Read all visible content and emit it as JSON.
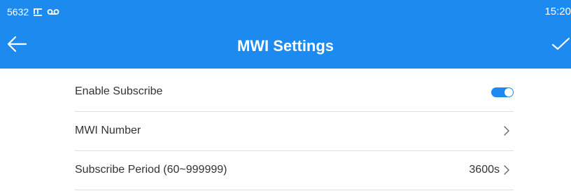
{
  "status_bar": {
    "extension": "5632",
    "time": "15:20",
    "icons": [
      "network-icon",
      "voicemail-icon"
    ]
  },
  "nav": {
    "title": "MWI Settings",
    "back_icon": "arrow-left-icon",
    "confirm_icon": "checkmark-icon"
  },
  "settings": {
    "enable_subscribe": {
      "label": "Enable Subscribe",
      "enabled": true
    },
    "mwi_number": {
      "label": "MWI Number",
      "value": ""
    },
    "subscribe_period": {
      "label": "Subscribe Period (60~999999)",
      "value": "3600s"
    }
  },
  "colors": {
    "accent": "#1d8af0",
    "text": "#333333",
    "divider": "#dedede"
  }
}
